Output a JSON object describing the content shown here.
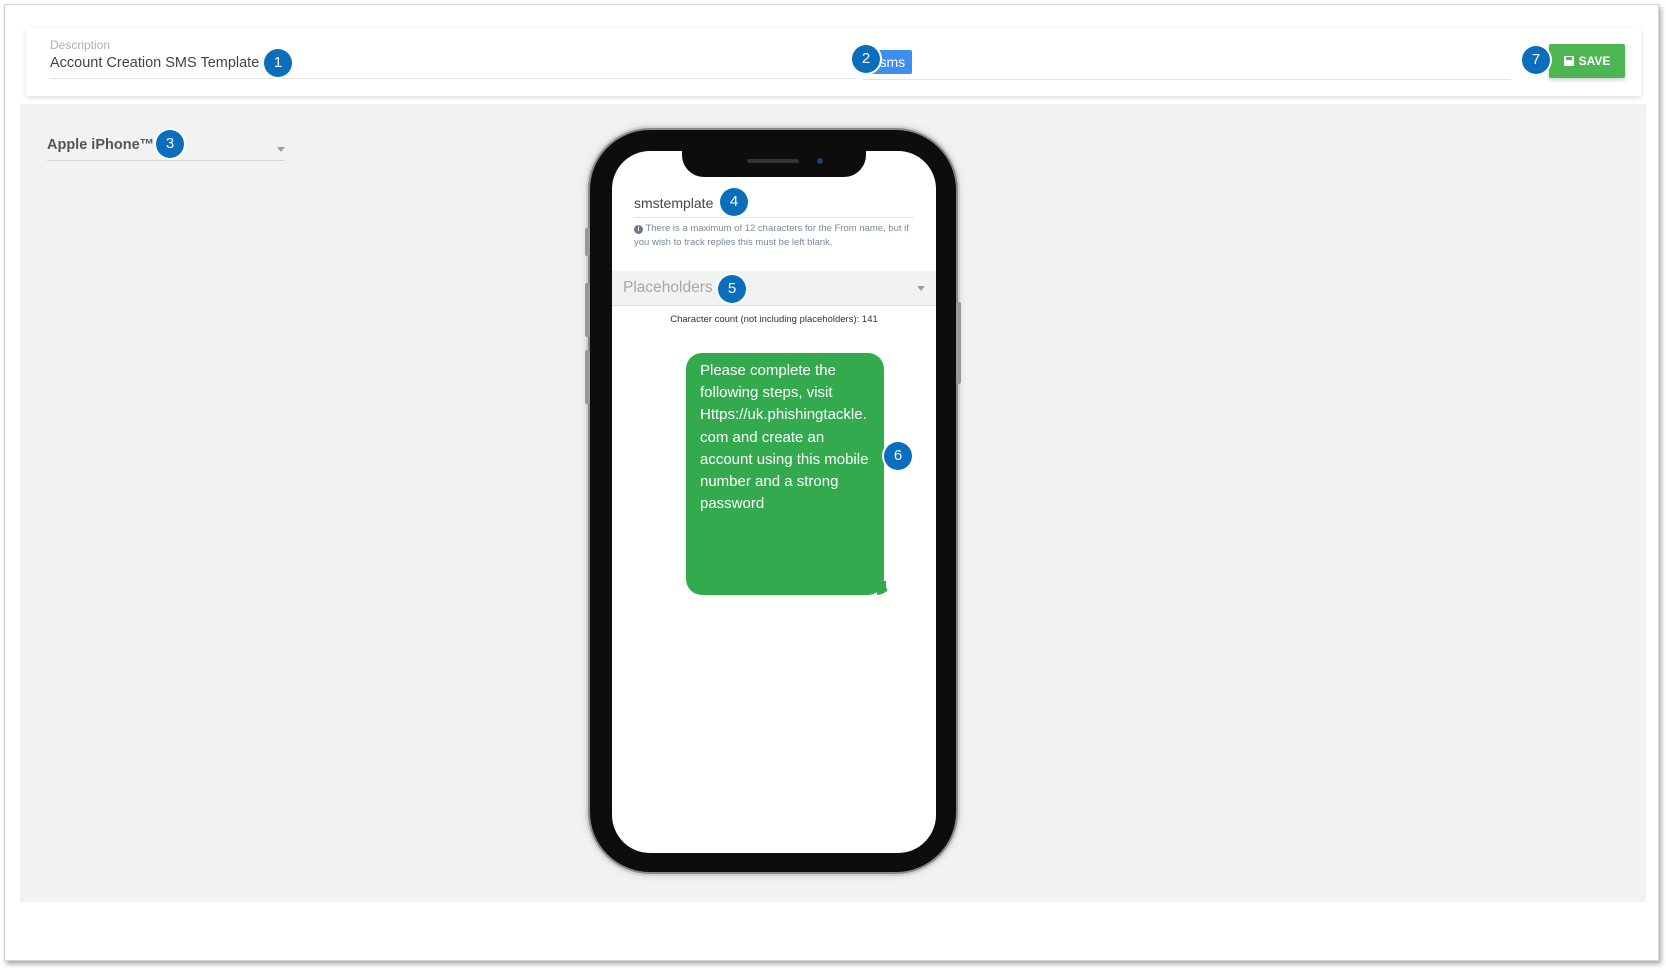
{
  "header": {
    "description_label": "Description",
    "description_value": "Account Creation SMS Template",
    "tags": [
      {
        "label": "sms",
        "remove_glyph": "×"
      }
    ],
    "save_label": "SAVE",
    "save_icon": "floppy-disk-icon"
  },
  "device": {
    "selected": "Apple iPhone™",
    "caret_icon": "chevron-down-icon"
  },
  "phone": {
    "from_name": "smstemplate",
    "info_glyph": "i",
    "from_hint": "There is a maximum of 12 characters for the From name, but if you wish to track replies this must be left blank.",
    "placeholders_label": "Placeholders",
    "character_count": "Character count (not including placeholders): 141",
    "message": "Please complete the following steps, visit Https://uk.phishingtackle.com and create an account using this mobile number and a strong password"
  },
  "annotations": [
    "1",
    "2",
    "3",
    "4",
    "5",
    "6",
    "7"
  ],
  "colors": {
    "accent_tag": "#3d8eef",
    "save_button": "#4eb553",
    "message_bubble": "#33aa4e",
    "badge": "#0a6ebd"
  }
}
